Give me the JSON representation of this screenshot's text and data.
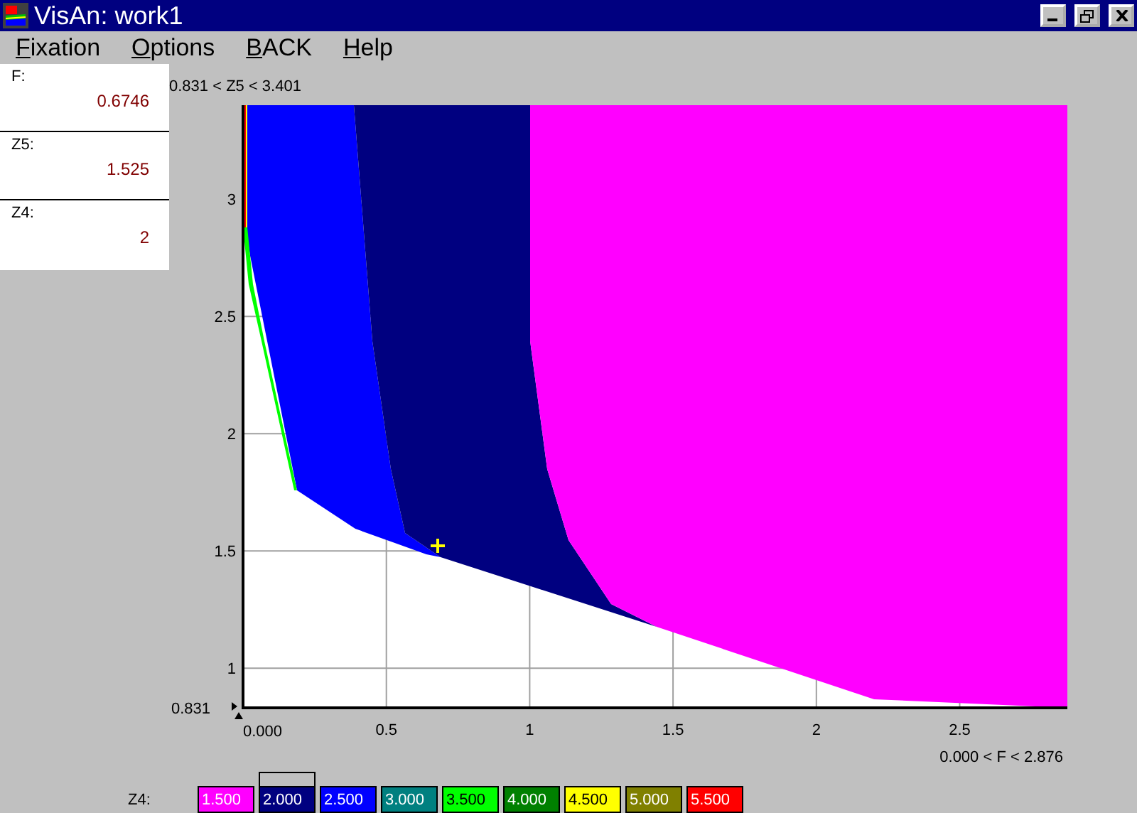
{
  "window": {
    "title": "VisAn: work1"
  },
  "menu": [
    {
      "key": "F",
      "rest": "ixation"
    },
    {
      "key": "O",
      "rest": "ptions"
    },
    {
      "key": "B",
      "rest": "ACK"
    },
    {
      "key": "H",
      "rest": "elp"
    }
  ],
  "fields": [
    {
      "label": "F:",
      "value": "0.6746"
    },
    {
      "label": "Z5:",
      "value": "1.525"
    },
    {
      "label": "Z4:",
      "value": "2"
    }
  ],
  "plot": {
    "y_range": "0.831 < Z5 < 3.401",
    "x_range": "0.000 < F < 2.876",
    "y_min": "0.831",
    "x_min": "0.000",
    "xticks": [
      "0.5",
      "1",
      "1.5",
      "2",
      "2.5"
    ],
    "yticks": [
      "3",
      "2.5",
      "2",
      "1.5",
      "1"
    ]
  },
  "legend": {
    "label": "Z4:",
    "items": [
      {
        "value": "1.500",
        "color": "#ff00ff",
        "selected": false
      },
      {
        "value": "2.000",
        "color": "#000080",
        "selected": true
      },
      {
        "value": "2.500",
        "color": "#0000ff",
        "selected": false
      },
      {
        "value": "3.000",
        "color": "#008080",
        "selected": false
      },
      {
        "value": "3.500",
        "color": "#00ff00",
        "selected": false
      },
      {
        "value": "4.000",
        "color": "#008000",
        "selected": false
      },
      {
        "value": "4.500",
        "color": "#ffff00",
        "selected": false
      },
      {
        "value": "5.000",
        "color": "#808000",
        "selected": false
      },
      {
        "value": "5.500",
        "color": "#ff0000",
        "selected": false
      }
    ]
  }
}
